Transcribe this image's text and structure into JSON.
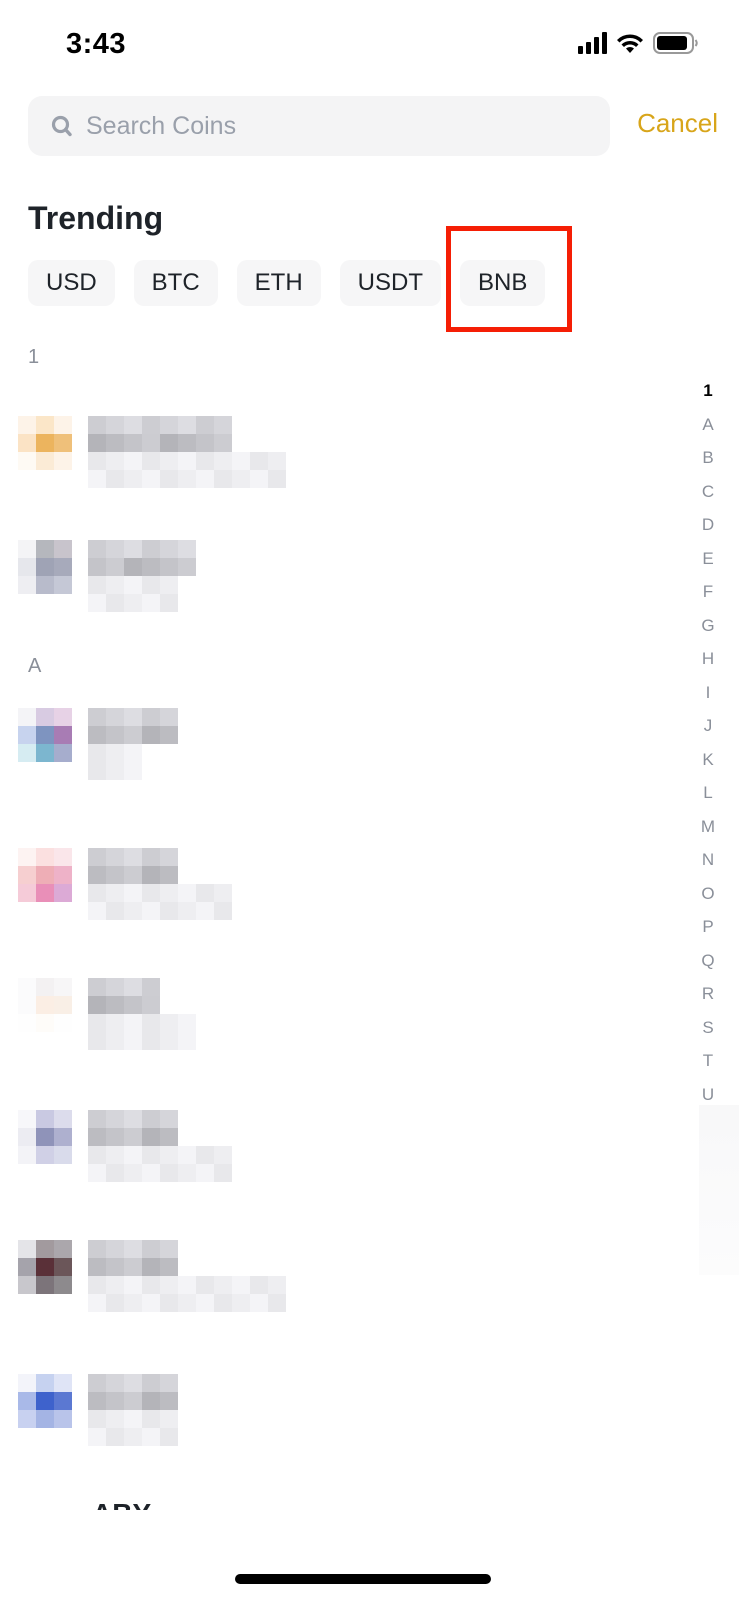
{
  "status_bar": {
    "time": "3:43",
    "icons": [
      "cellular-signal-icon",
      "wifi-icon",
      "battery-icon"
    ]
  },
  "search": {
    "placeholder": "Search Coins",
    "value": "",
    "icon": "search-icon",
    "cancel_label": "Cancel"
  },
  "colors": {
    "accent": "#d8a51a",
    "highlight": "#f51e05",
    "chip_bg": "#f6f6f7",
    "search_bg": "#f4f4f5",
    "muted_text": "#8a8f99"
  },
  "trending": {
    "title": "Trending",
    "chips": [
      {
        "label": "USD"
      },
      {
        "label": "BTC"
      },
      {
        "label": "ETH"
      },
      {
        "label": "USDT"
      },
      {
        "label": "BNB",
        "highlighted": true
      }
    ]
  },
  "sections": [
    {
      "header": "1",
      "items": [
        {
          "obscured": true,
          "icon_colors": [
            [
              "#fdf3e8",
              "#fbe6c8",
              "#fdf3e8"
            ],
            [
              "#fbe3c5",
              "#ecb45e",
              "#efc07a"
            ],
            [
              "#fefaf4",
              "#fbebd6",
              "#fdf3e8"
            ]
          ]
        },
        {
          "obscured": true,
          "icon_colors": [
            [
              "#f4f4f6",
              "#b5b7bd",
              "#c8c4cc"
            ],
            [
              "#e6e7ec",
              "#9fa3b5",
              "#a7aabb"
            ],
            [
              "#eeeef2",
              "#b8bbcb",
              "#c5c8d6"
            ]
          ]
        }
      ]
    },
    {
      "header": "A",
      "items": [
        {
          "obscured": true,
          "icon_colors": [
            [
              "#f4f4f7",
              "#d8cbe2",
              "#e7d2e6"
            ],
            [
              "#c7d3ee",
              "#7e94c0",
              "#a87cb4"
            ],
            [
              "#d6ecf2",
              "#7cb6cf",
              "#a6adcd"
            ]
          ]
        },
        {
          "obscured": true,
          "icon_colors": [
            [
              "#fdf3f2",
              "#fbe0e0",
              "#fae6ea"
            ],
            [
              "#f6cfd0",
              "#eeaeb6",
              "#eeb2c8"
            ],
            [
              "#f5cbd8",
              "#e98fb8",
              "#dcaad6"
            ]
          ]
        },
        {
          "obscured": true,
          "icon_colors": [
            [
              "#fbfbfc",
              "#f3f1f2",
              "#f7f6f7"
            ],
            [
              "#fbfbfc",
              "#fbeee4",
              "#f9efe6"
            ],
            [
              "#fefefe",
              "#fefcf9",
              "#fefefe"
            ]
          ]
        },
        {
          "obscured": true,
          "icon_colors": [
            [
              "#f7f7fa",
              "#c9c9e2",
              "#dcdcec"
            ],
            [
              "#ececf2",
              "#8f93b9",
              "#aeb0cf"
            ],
            [
              "#f3f3f7",
              "#d0d0e6",
              "#d9dbeb"
            ]
          ]
        },
        {
          "obscured": true,
          "icon_colors": [
            [
              "#e4e4e8",
              "#a29a9e",
              "#aba7ac"
            ],
            [
              "#a5a3ab",
              "#5a3038",
              "#6b5659"
            ],
            [
              "#c8c7cc",
              "#7c747a",
              "#8d8a8d"
            ]
          ]
        },
        {
          "obscured": true,
          "icon_colors": [
            [
              "#f3f4fa",
              "#c6d2f0",
              "#dfe4f6"
            ],
            [
              "#a9b9e8",
              "#3e62cc",
              "#5b78d2"
            ],
            [
              "#c8d1f0",
              "#a4b4e4",
              "#b9c4ea"
            ]
          ]
        }
      ]
    }
  ],
  "index_bar": {
    "letters": [
      "1",
      "A",
      "B",
      "C",
      "D",
      "E",
      "F",
      "G",
      "H",
      "I",
      "J",
      "K",
      "L",
      "M",
      "N",
      "O",
      "P",
      "Q",
      "R",
      "S",
      "T",
      "U"
    ],
    "active": "1"
  },
  "peek_text": "ABY"
}
